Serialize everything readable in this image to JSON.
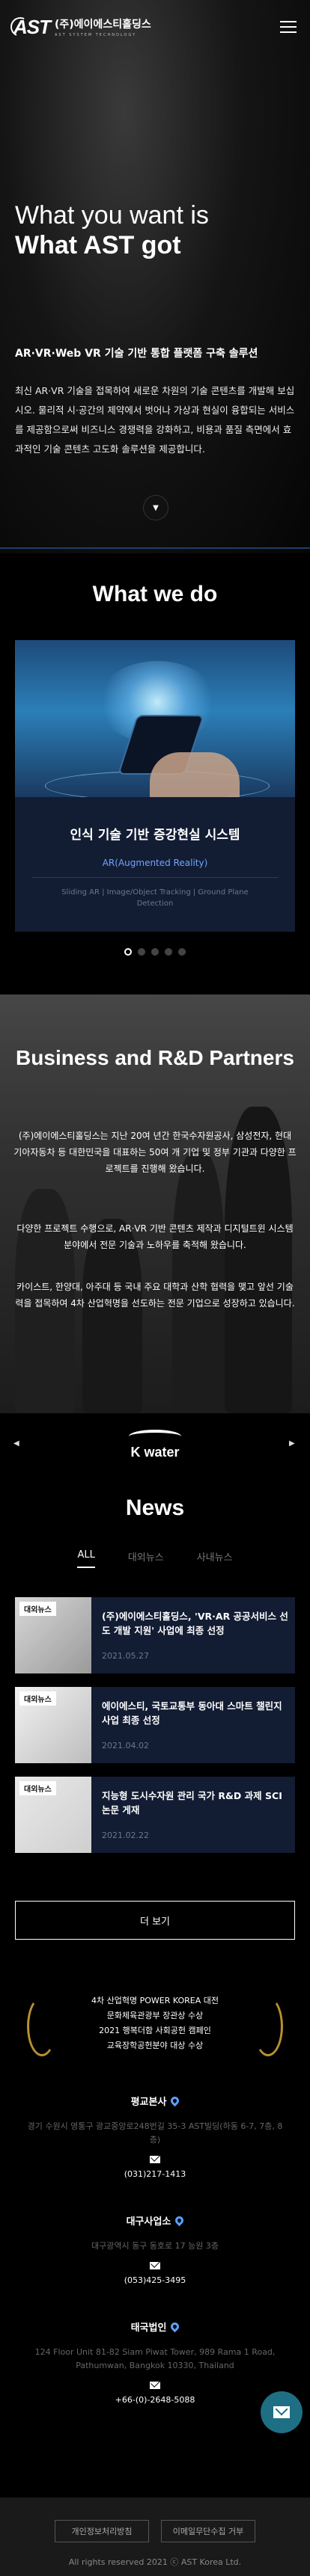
{
  "header": {
    "logo_mark": "AST",
    "logo_name": "(주)에이에스티홀딩스",
    "logo_sub": "AST SYSTEM TECHNOLOGY"
  },
  "hero": {
    "line1": "What you want is",
    "line2": "What AST got",
    "tagline": "AR·VR·Web VR 기술 기반 통합 플랫폼 구축 솔루션",
    "description": "최신 AR·VR 기술을 접목하여 새로운 차원의 기술 콘텐츠를 개발해 보십시오. 물리적 시·공간의 제약에서 벗어나 가상과 현실이 융합되는 서비스를 제공함으로써 비즈니스 경쟁력을 강화하고, 비용과 품질 측면에서 효과적인 기술 콘텐츠 고도화 솔루션을 제공합니다."
  },
  "what_we_do": {
    "title": "What we do",
    "slide": {
      "title": "인식 기술 기반 증강현실 시스템",
      "subtitle": "AR(Augmented Reality)",
      "tags": "Sliding AR | Image/Object Tracking | Ground Plane Detection"
    },
    "slide_count": 5,
    "active_slide": 1
  },
  "business": {
    "title": "Business and R&D Partners",
    "p1": "(주)에이에스티홀딩스는 지난 20여 년간 한국수자원공사, 삼성전자, 현대 기아자동차 등 대한민국을 대표하는 50여 개 기업 및 정부 기관과 다양한 프로젝트를 진행해 왔습니다.",
    "p2": "다양한 프로젝트 수행으로, AR·VR 기반 콘텐츠 제작과 디지털트윈 시스템 분야에서 전문 기술과 노하우를 축적해 왔습니다.",
    "p3": "카이스트, 한양대, 아주대 등 국내 주요 대학과 산학 협력을 맺고 앞선 기술력을 접목하여 4차 산업혁명을 선도하는 전문 기업으로 성장하고 있습니다."
  },
  "partner": {
    "logo_text": "K water"
  },
  "news": {
    "title": "News",
    "tabs": [
      "ALL",
      "대외뉴스",
      "사내뉴스"
    ],
    "items": [
      {
        "badge": "대외뉴스",
        "headline": "(주)에이에스티홀딩스, 'VR·AR 공공서비스 선도 개발 지원' 사업에 최종 선정",
        "date": "2021.05.27"
      },
      {
        "badge": "대외뉴스",
        "headline": "에이에스티, 국토교통부 동아대 스마트 챌린지 사업 최종 선정",
        "date": "2021.04.02"
      },
      {
        "badge": "대외뉴스",
        "headline": "지능형 도시수자원 관리 국가 R&D 과제 SCI 논문 게재",
        "date": "2021.02.22"
      }
    ],
    "more_label": "더 보기"
  },
  "award": {
    "line1": "4차 산업혁명 POWER KOREA 대전",
    "line2": "문화체육관광부 장관상 수상",
    "line3": "2021 행복더함 사회공헌 캠페인",
    "line4": "교육장학공헌분야 대상 수상"
  },
  "contacts": [
    {
      "title": "평교본사",
      "address": "경기 수원시 영통구 광교중앙로248번길 35-3 AST빌딩(하동 6-7, 7층, 8층)",
      "phone": "(031)217-1413"
    },
    {
      "title": "대구사업소",
      "address": "대구광역시 동구 동호로 17 능원 3층",
      "phone": "(053)425-3495"
    },
    {
      "title": "태국법인",
      "address": "124 Floor Unit 81-82 Siam Piwat Tower, 989 Rama 1 Road, Pathumwan, Bangkok 10330, Thailand",
      "phone": "+66-(0)-2648-5088"
    }
  ],
  "footer": {
    "privacy": "개인정보처리방침",
    "email_policy": "이메일무단수집 거부",
    "copyright": "All rights reserved 2021 ⓒ AST Korea Ltd."
  }
}
